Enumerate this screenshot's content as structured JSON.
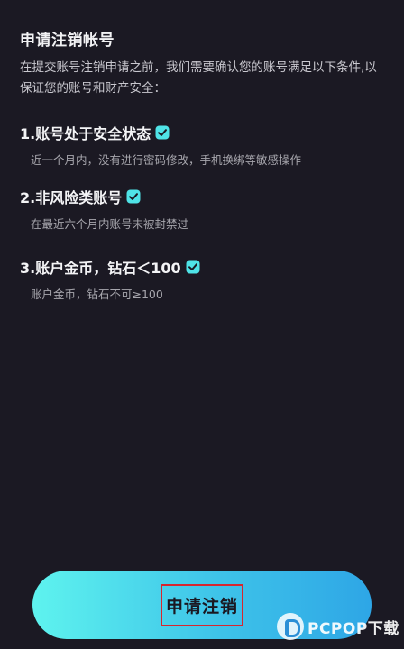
{
  "page": {
    "title": "申请注销帐号",
    "intro": "在提交账号注销申请之前，我们需要确认您的账号满足以下条件,以保证您的账号和财产安全："
  },
  "conditions": [
    {
      "title": "1.账号处于安全状态",
      "desc": "近一个月内，没有进行密码修改，手机换绑等敏感操作",
      "icon": "check-badge-icon"
    },
    {
      "title": "2.非风险类账号",
      "desc": "在最近六个月内账号未被封禁过",
      "icon": "check-badge-icon"
    },
    {
      "title": "3.账户金币，钻石＜100",
      "desc": "账户金币，钻石不可≥100",
      "icon": "check-badge-icon"
    }
  ],
  "action": {
    "submit_label": "申请注销"
  },
  "watermark": {
    "text": "PCPOP下载"
  },
  "colors": {
    "background": "#1b1923",
    "accent": "#3ec3e9",
    "check": "#4fe3e7",
    "highlight_border": "#d8262e"
  }
}
